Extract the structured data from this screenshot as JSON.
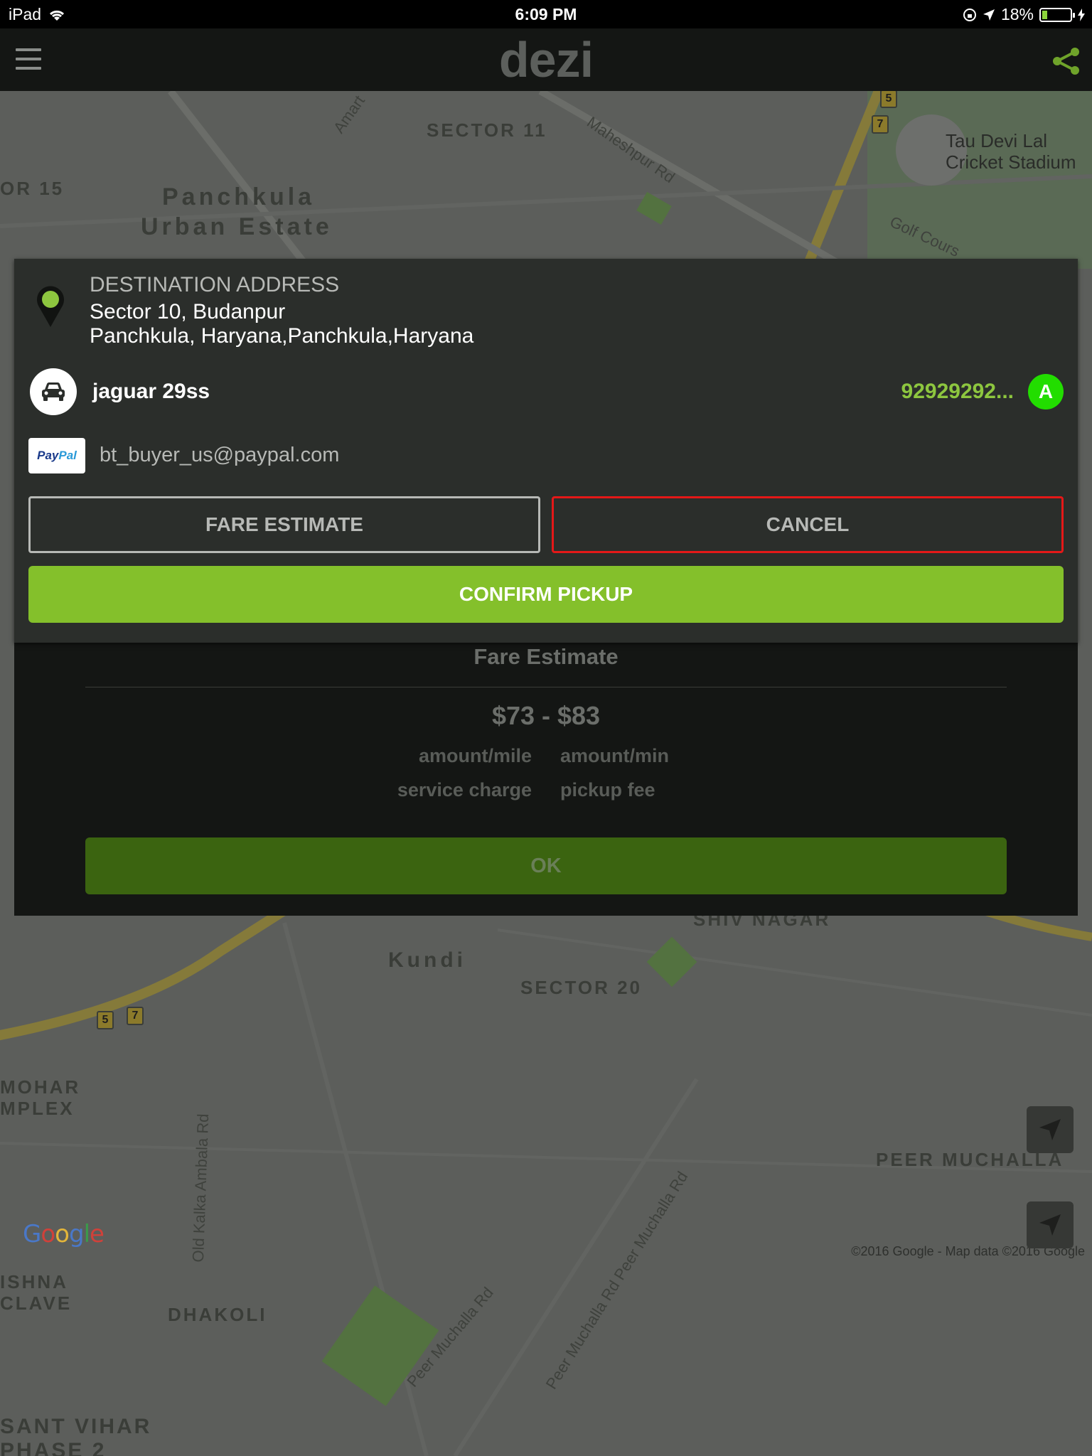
{
  "status_bar": {
    "device": "iPad",
    "time": "6:09 PM",
    "battery_percent": "18%",
    "battery_level": 0.18,
    "icons": [
      "wifi-icon",
      "rotation-lock-icon",
      "location-arrow-icon",
      "battery-icon",
      "charging-icon"
    ]
  },
  "nav_bar": {
    "logo": "dezi",
    "menu_icon": "hamburger-menu-icon",
    "share_icon": "share-icon"
  },
  "map": {
    "labels": {
      "sector_11": "SECTOR 11",
      "or_15": "OR 15",
      "panchkula": "Panchkula",
      "urban_estate": "Urban Estate",
      "amart": "Amart",
      "maheshpur_rd": "Maheshpur Rd",
      "stadium_line1": "Tau Devi Lal",
      "stadium_line2": "Cricket Stadium",
      "golf_cours": "Golf Cours",
      "shiv_nagar": "SHIV NAGAR",
      "kundi": "Kundi",
      "sector_20": "SECTOR 20",
      "mohar": "MOHAR",
      "mplex": "MPLEX",
      "old_kalka": "Old Kalka Ambala Rd",
      "peer_muchalla_rd_diag": "Peer Muchalla Rd Peer Muchalla Rd",
      "peer_muchalla": "PEER MUCHALLA",
      "peer_muchalla_rd": "Peer Muchalla Rd",
      "ishna": "ISHNA",
      "clave": "CLAVE",
      "dhakoli": "DHAKOLI",
      "sant_vihar": "SANT VIHAR",
      "phase_2": "PHASE 2"
    },
    "shields": [
      "5",
      "7",
      "5",
      "7"
    ],
    "google_logo": "Google",
    "copyright": "©2016 Google - Map data ©2016 Google",
    "locate_icon": "location-arrow-icon"
  },
  "pickup_card": {
    "destination_heading": "DESTINATION ADDRESS",
    "destination_line1": "Sector 10, Budanpur",
    "destination_line2": "Panchkula, Haryana,Panchkula,Haryana",
    "car_name": "jaguar 29ss",
    "driver_phone": "92929292...",
    "driver_initial": "A",
    "payment_brand": "PayPal",
    "payment_email": "bt_buyer_us@paypal.com",
    "fare_estimate_label": "FARE ESTIMATE",
    "cancel_label": "CANCEL",
    "confirm_label": "CONFIRM PICKUP"
  },
  "fare_dialog": {
    "title": "Fare Estimate",
    "range": "$73 - $83",
    "rows": [
      {
        "left": "amount/mile",
        "right": "amount/min"
      },
      {
        "left": "service charge",
        "right": "pickup fee"
      }
    ],
    "ok_label": "OK"
  },
  "colors": {
    "accent_green": "#84c02b",
    "driver_green": "#22dd00",
    "cancel_red": "#e41818",
    "card_bg": "#2b2e2b"
  }
}
